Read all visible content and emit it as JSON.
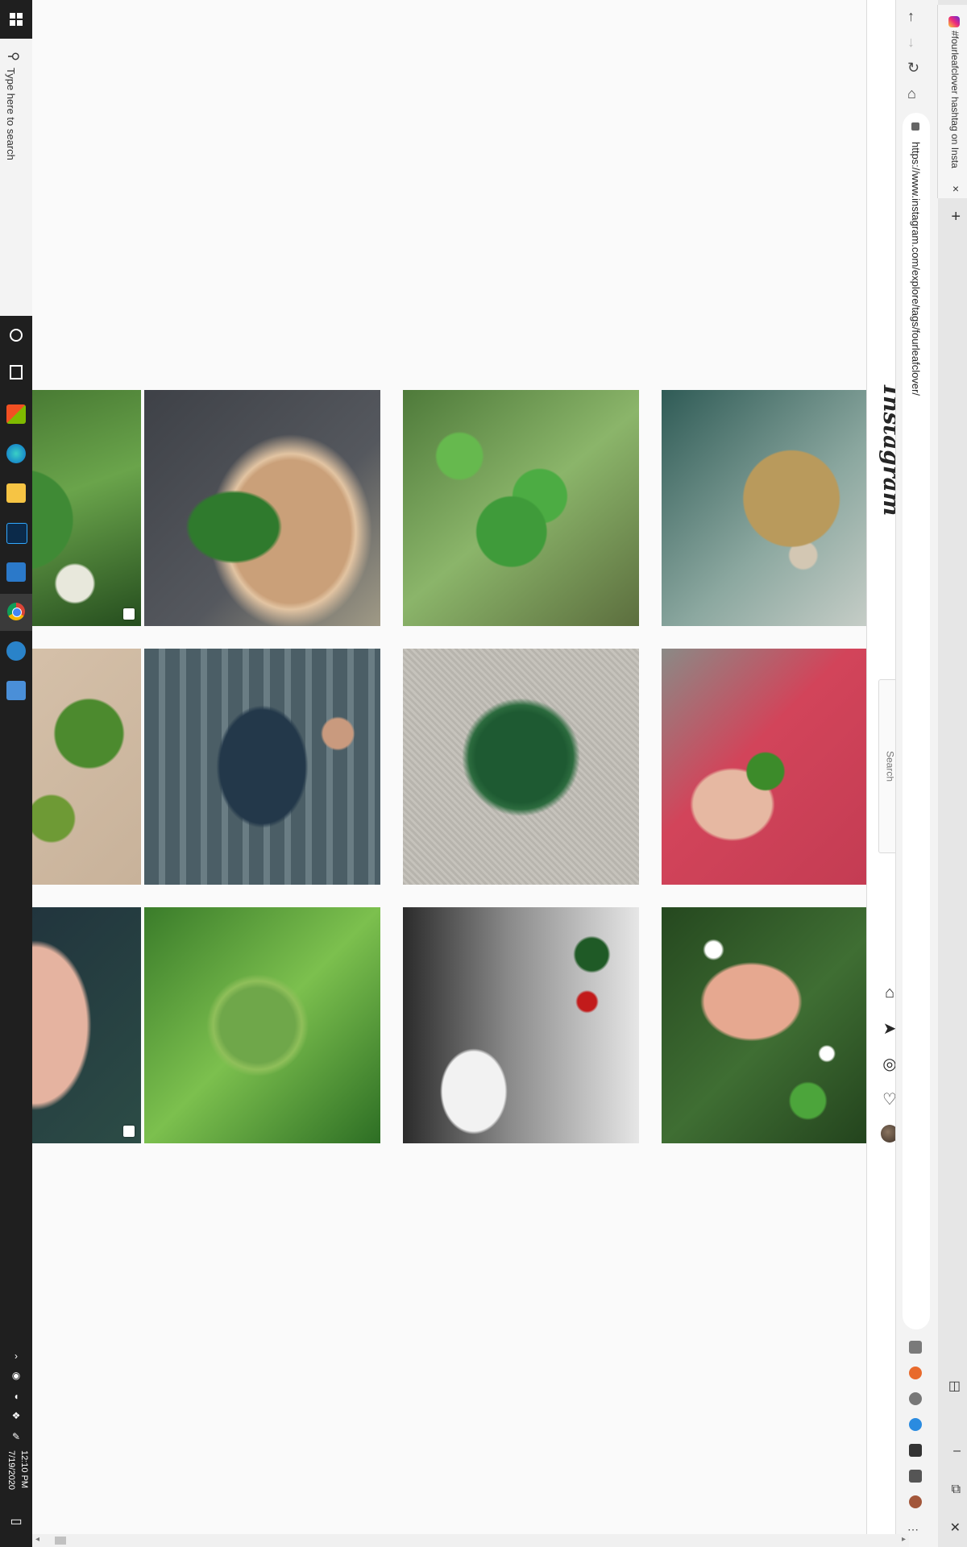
{
  "taskbar": {
    "search_placeholder": "Type here to search",
    "clock": {
      "time": "12:10 PM",
      "date": "7/19/2020"
    }
  },
  "browser": {
    "tab_title": "#fourleafclover hashtag on Insta",
    "url": "https://www.instagram.com/explore/tags/fourleafclover/",
    "tab_close_label": "×",
    "new_tab_label": "+",
    "window_controls": {
      "minimize": "–",
      "restore": "⧉",
      "close": "✕"
    }
  },
  "instagram": {
    "logo": "Instagram",
    "search_placeholder": "Search",
    "nav_icons": [
      "home-icon",
      "direct-icon",
      "explore-icon",
      "activity-icon",
      "profile-avatar"
    ]
  },
  "grid": {
    "rows": [
      [
        "clover-flower-partial",
        "dog-with-clover",
        "green-clover-plant",
        "pressed-four-leaf-clover"
      ],
      [
        "clover-on-wood-partial",
        "man-on-stairs",
        "large-four-leaf-clover",
        "hand-holding-clover"
      ],
      [
        "hand-clovers-partial",
        "clover-patch",
        "still-life-clover-teacup",
        "hand-picking-clover"
      ]
    ],
    "multi_post_tiles": [
      "clover-flower-partial",
      "hand-clovers-partial"
    ]
  }
}
